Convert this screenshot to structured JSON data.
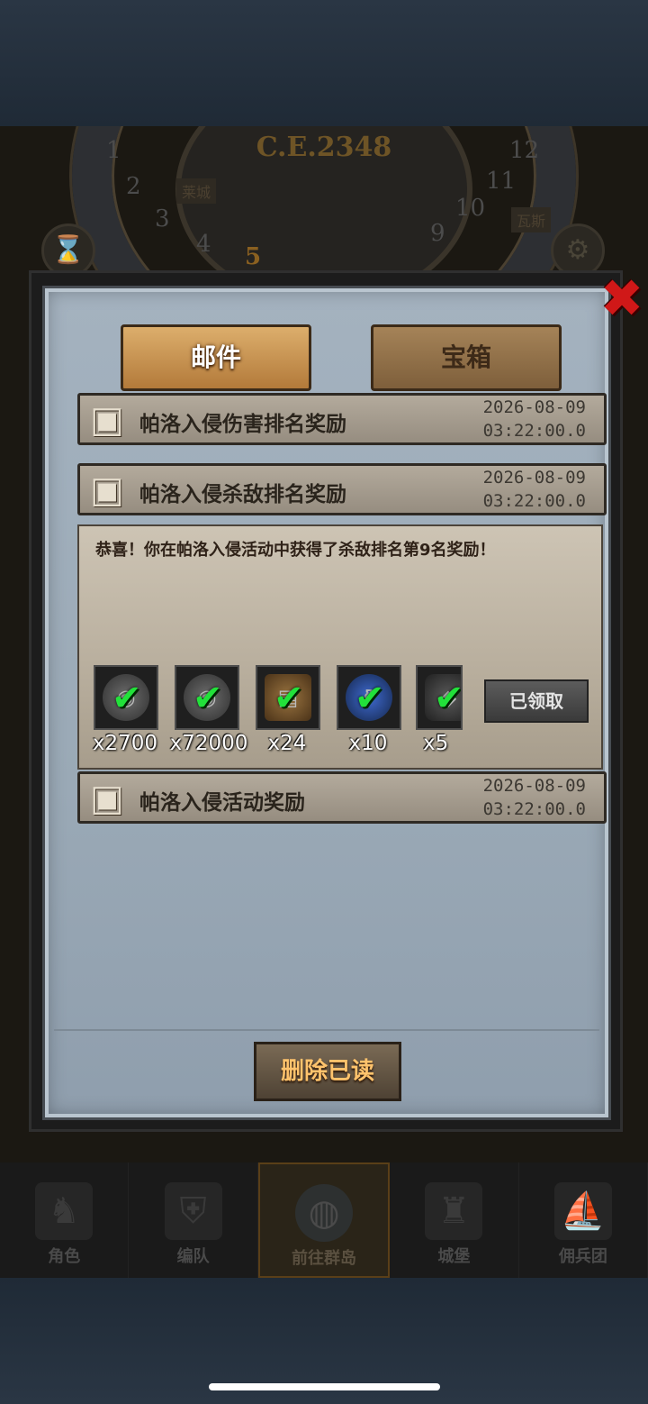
{
  "background": {
    "year": "C.E.2348",
    "dial_numbers": [
      "1",
      "2",
      "3",
      "4",
      "5",
      "9",
      "10",
      "11",
      "12"
    ],
    "active_number": "5",
    "city_labels": [
      "莱城",
      "瓦斯"
    ]
  },
  "dialog": {
    "tabs": [
      {
        "label": "邮件",
        "active": true
      },
      {
        "label": "宝箱",
        "active": false
      }
    ],
    "mails": [
      {
        "title": "帕洛入侵伤害排名奖励",
        "date": "2026-08-09",
        "time": "03:22:00.0"
      },
      {
        "title": "帕洛入侵杀敌排名奖励",
        "date": "2026-08-09",
        "time": "03:22:00.0"
      },
      {
        "title": "帕洛入侵活动奖励",
        "date": "2026-08-09",
        "time": "03:22:00.0"
      }
    ],
    "opened_mail": {
      "message": "恭喜！你在帕洛入侵活动中获得了杀敌排名第9名奖励！",
      "rewards": [
        {
          "icon": "silver-coin-icon",
          "count": "x2700"
        },
        {
          "icon": "iron-coin-icon",
          "count": "x72000"
        },
        {
          "icon": "treasure-bag-icon",
          "count": "x24"
        },
        {
          "icon": "potion-icon",
          "count": "x10"
        },
        {
          "icon": "ore-icon",
          "count": "x5"
        }
      ],
      "claimed_label": "已领取"
    },
    "delete_read_label": "删除已读"
  },
  "bottom_nav": [
    {
      "label": "角色",
      "icon": "knight-icon"
    },
    {
      "label": "编队",
      "icon": "helmet-icon"
    },
    {
      "label": "前往群岛",
      "icon": "globe-icon",
      "active": true
    },
    {
      "label": "城堡",
      "icon": "castle-icon"
    },
    {
      "label": "佣兵团",
      "icon": "ship-icon"
    }
  ],
  "colors": {
    "accent_gold": "#ffc36c",
    "check_green": "#22e13a",
    "close_red": "#d01818"
  }
}
